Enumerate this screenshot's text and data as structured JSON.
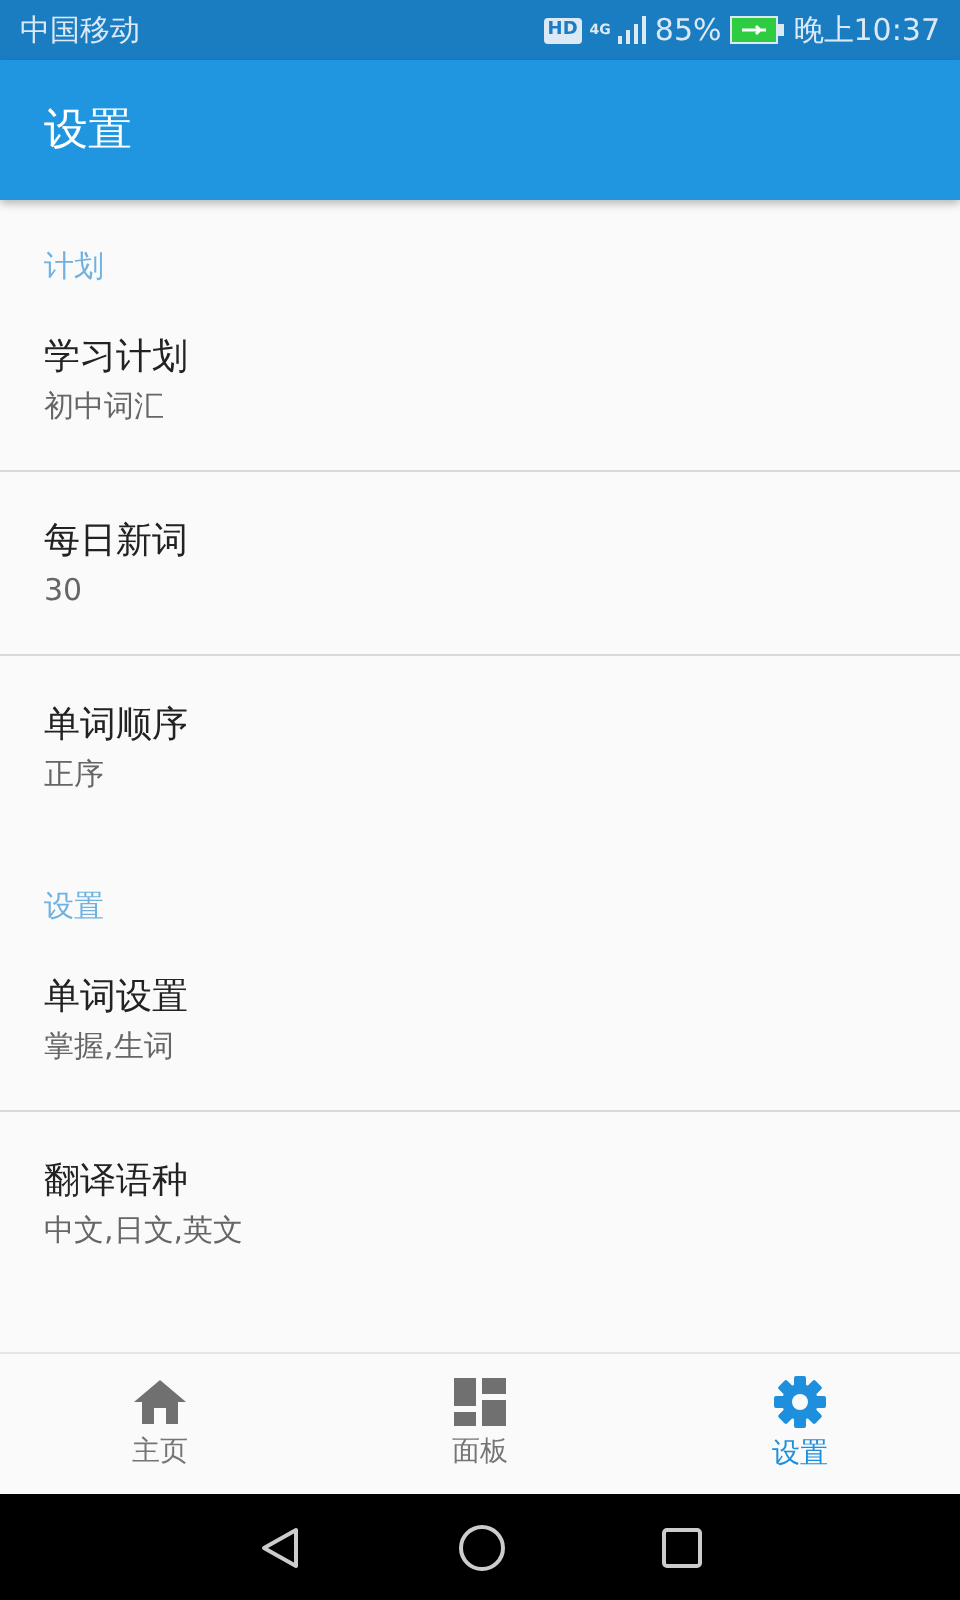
{
  "status_bar": {
    "carrier": "中国移动",
    "hd": "HD",
    "network": "4G",
    "battery": "85%",
    "time": "晚上10:37"
  },
  "app_bar": {
    "title": "设置"
  },
  "sections": [
    {
      "title": "计划",
      "items": [
        {
          "title": "学习计划",
          "value": "初中词汇"
        },
        {
          "title": "每日新词",
          "value": "30"
        },
        {
          "title": "单词顺序",
          "value": "正序"
        }
      ]
    },
    {
      "title": "设置",
      "items": [
        {
          "title": "单词设置",
          "value": "掌握,生词"
        },
        {
          "title": "翻译语种",
          "value": "中文,日文,英文"
        }
      ]
    }
  ],
  "bottom_nav": [
    {
      "kind": "home",
      "label": "主页",
      "selected": false
    },
    {
      "kind": "dashboard",
      "label": "面板",
      "selected": false
    },
    {
      "kind": "settings",
      "label": "设置",
      "selected": true
    }
  ]
}
